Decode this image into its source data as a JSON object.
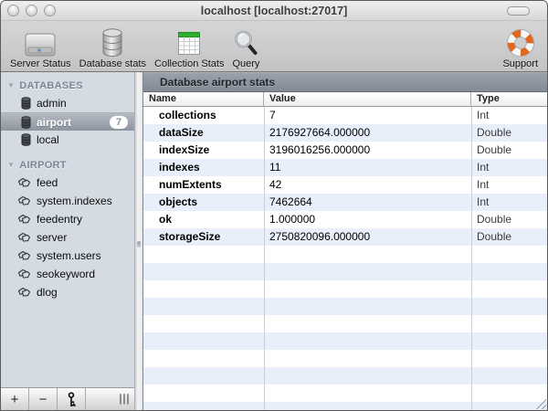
{
  "window": {
    "title": "localhost [localhost:27017]"
  },
  "toolbar": {
    "items": [
      {
        "label": "Server Status",
        "icon": "server-icon",
        "align": "left"
      },
      {
        "label": "Database stats",
        "icon": "database-icon",
        "align": "left"
      },
      {
        "label": "Collection Stats",
        "icon": "table-icon",
        "align": "left"
      },
      {
        "label": "Query",
        "icon": "magnifier-icon",
        "align": "left"
      },
      {
        "label": "Support",
        "icon": "lifering-icon",
        "align": "right"
      }
    ]
  },
  "sidebar": {
    "groups": [
      {
        "label": "DATABASES",
        "items": [
          {
            "label": "admin",
            "icon": "database-small-icon",
            "selected": false,
            "badge": ""
          },
          {
            "label": "airport",
            "icon": "database-small-icon",
            "selected": true,
            "badge": "7"
          },
          {
            "label": "local",
            "icon": "database-small-icon",
            "selected": false,
            "badge": ""
          }
        ]
      },
      {
        "label": "AIRPORT",
        "items": [
          {
            "label": "feed",
            "icon": "collection-icon",
            "selected": false,
            "badge": ""
          },
          {
            "label": "system.indexes",
            "icon": "collection-icon",
            "selected": false,
            "badge": ""
          },
          {
            "label": "feedentry",
            "icon": "collection-icon",
            "selected": false,
            "badge": ""
          },
          {
            "label": "server",
            "icon": "collection-icon",
            "selected": false,
            "badge": ""
          },
          {
            "label": "system.users",
            "icon": "collection-icon",
            "selected": false,
            "badge": ""
          },
          {
            "label": "seokeyword",
            "icon": "collection-icon",
            "selected": false,
            "badge": ""
          },
          {
            "label": "dlog",
            "icon": "collection-icon",
            "selected": false,
            "badge": ""
          }
        ]
      }
    ],
    "footer": {
      "buttons": [
        {
          "name": "add",
          "icon": "plus-icon",
          "glyph": "+"
        },
        {
          "name": "remove",
          "icon": "minus-icon",
          "glyph": "−"
        },
        {
          "name": "auth",
          "icon": "key-icon",
          "glyph": ""
        }
      ]
    }
  },
  "main": {
    "panel_title": "Database airport stats",
    "table": {
      "columns": [
        "Name",
        "Value",
        "Type"
      ],
      "rows": [
        {
          "name": "collections",
          "value": "7",
          "type": "Int"
        },
        {
          "name": "dataSize",
          "value": "2176927664.000000",
          "type": "Double"
        },
        {
          "name": "indexSize",
          "value": "3196016256.000000",
          "type": "Double"
        },
        {
          "name": "indexes",
          "value": "11",
          "type": "Int"
        },
        {
          "name": "numExtents",
          "value": "42",
          "type": "Int"
        },
        {
          "name": "objects",
          "value": "7462664",
          "type": "Int"
        },
        {
          "name": "ok",
          "value": "1.000000",
          "type": "Double"
        },
        {
          "name": "storageSize",
          "value": "2750820096.000000",
          "type": "Double"
        }
      ]
    }
  },
  "colors": {
    "stripe_blue": "#e8effa",
    "sidebar_bg": "#d4dbe2",
    "selection_top": "#b5bbc3",
    "selection_bottom": "#8d95a0",
    "panel_header_top": "#99a2ab",
    "panel_header_bottom": "#828b95",
    "badge_text": "#8b939e",
    "collection_stats_green": "#2fae2f",
    "support_orange": "#e5641e"
  }
}
